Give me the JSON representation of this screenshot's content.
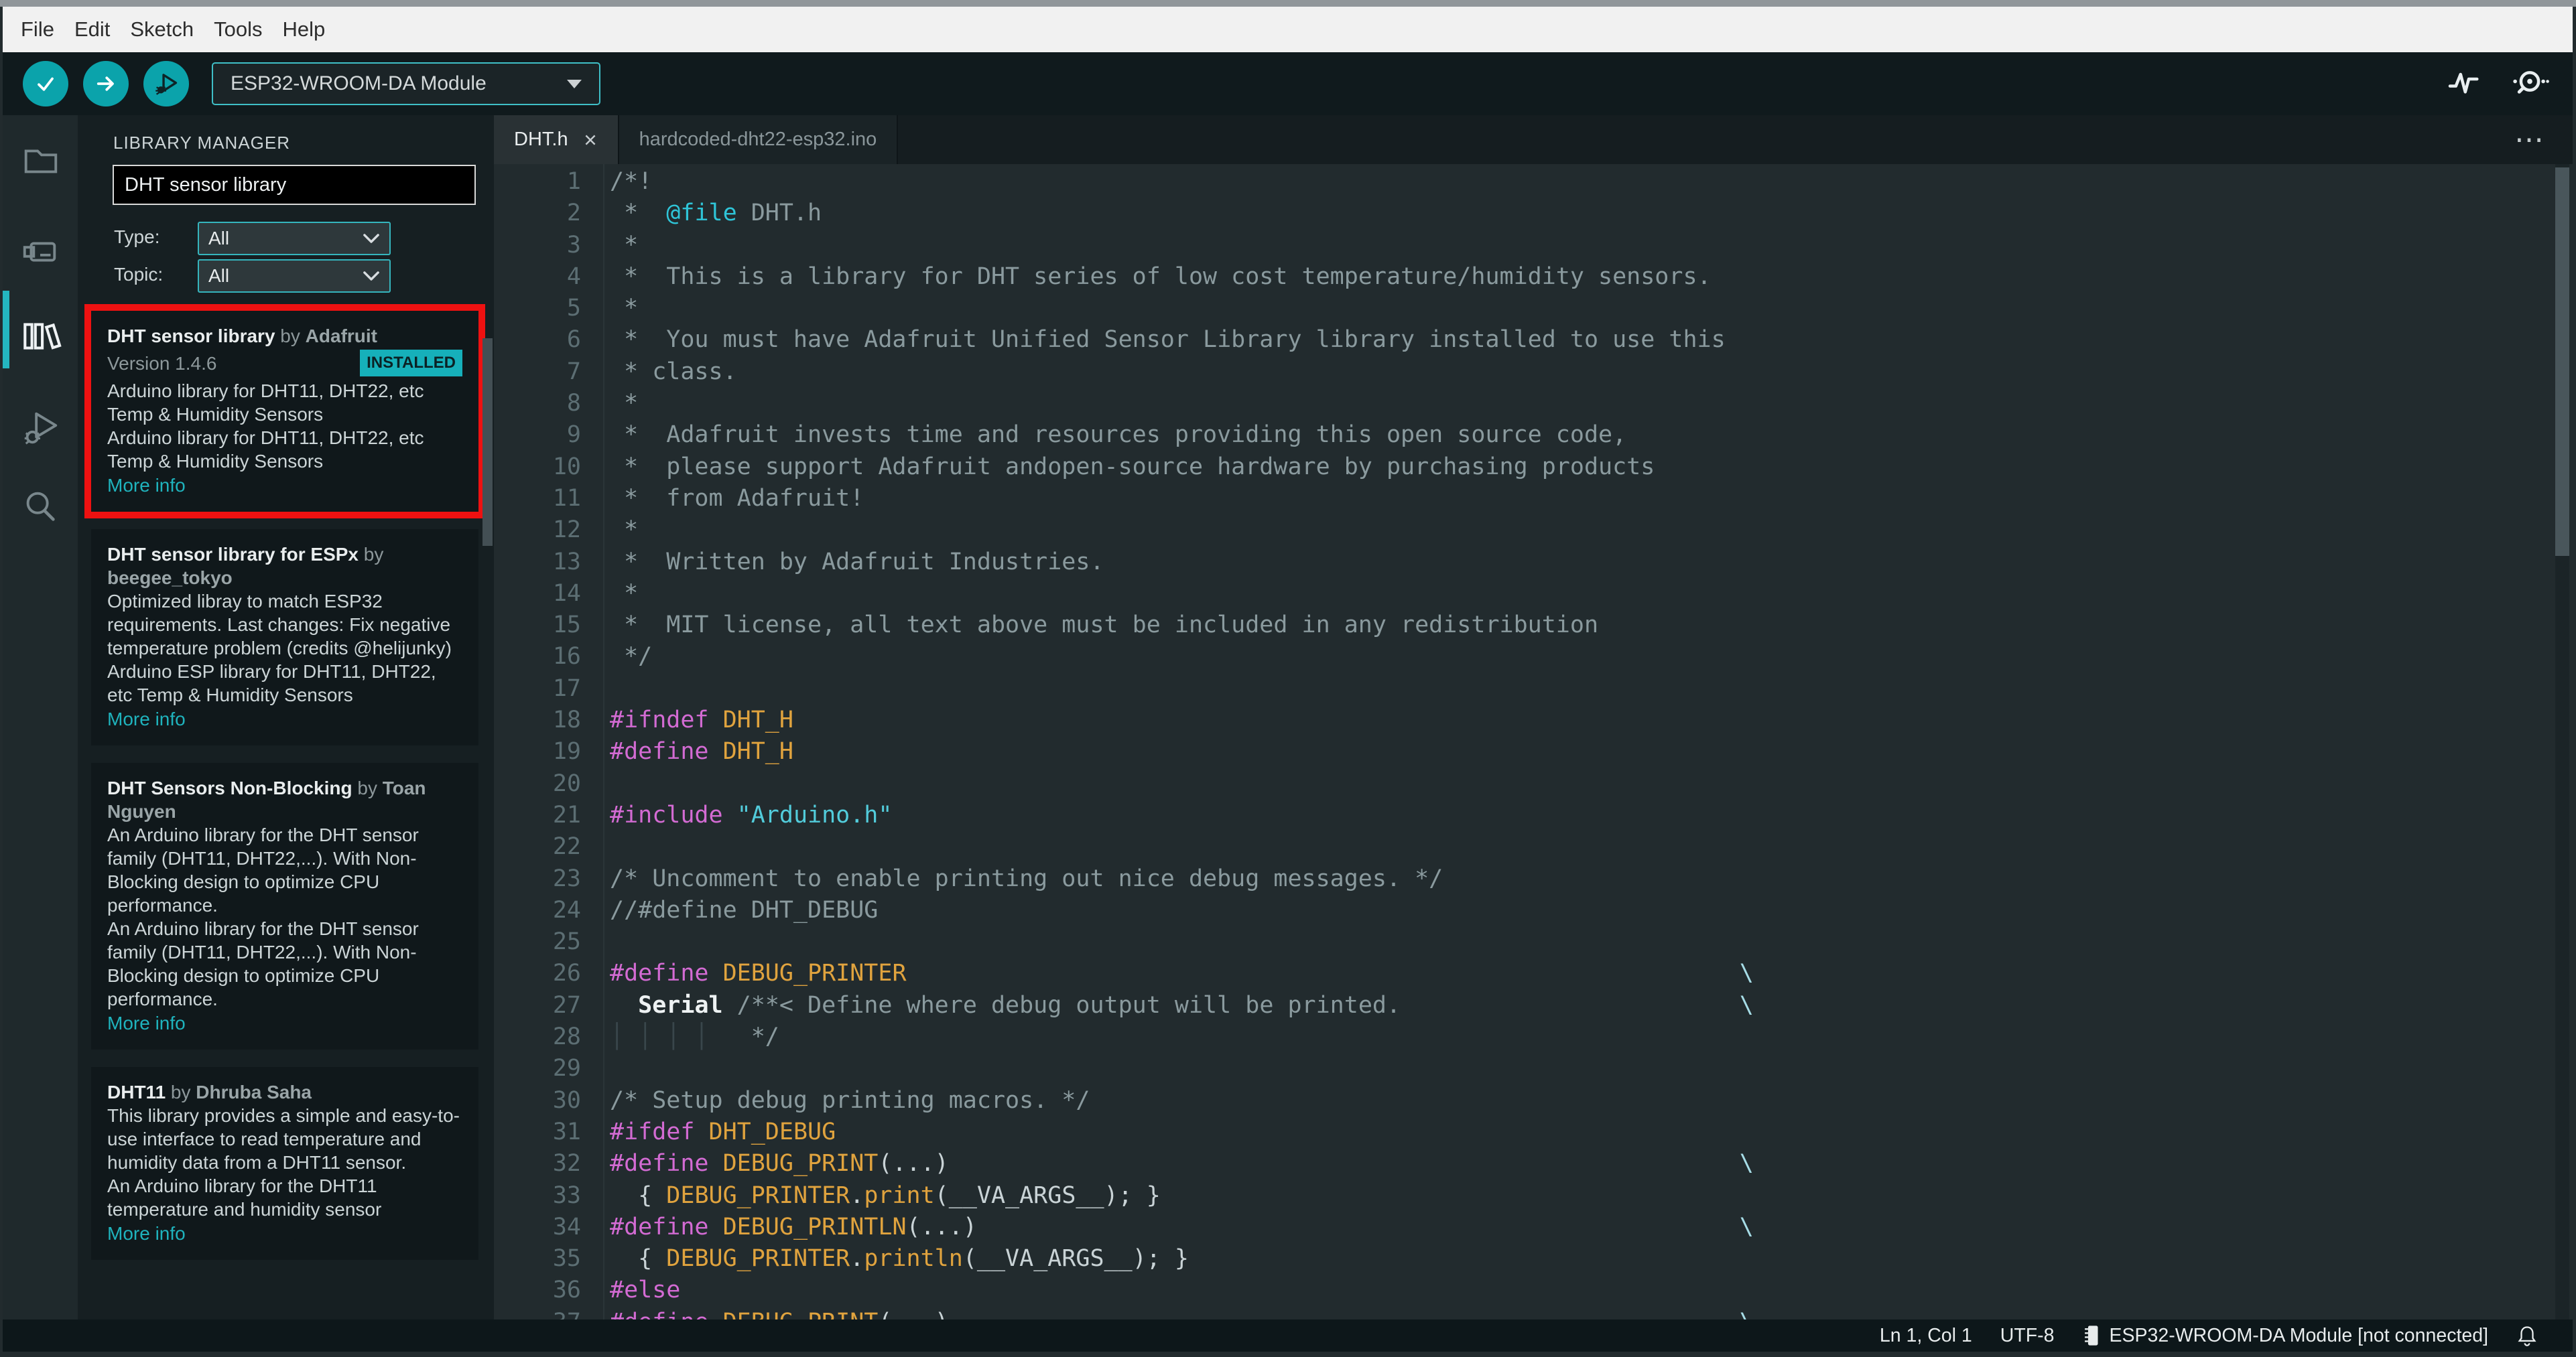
{
  "menubar": {
    "items": [
      {
        "label": "File"
      },
      {
        "label": "Edit"
      },
      {
        "label": "Sketch"
      },
      {
        "label": "Tools"
      },
      {
        "label": "Help"
      }
    ]
  },
  "toolbar": {
    "buttons": [
      {
        "name": "verify-button",
        "icon": "check-icon"
      },
      {
        "name": "upload-button",
        "icon": "arrow-right-icon"
      },
      {
        "name": "debug-button",
        "icon": "bug-play-icon"
      }
    ],
    "board_selector": {
      "value": "ESP32-WROOM-DA Module",
      "icon": "chevron-down-icon"
    },
    "right_icons": [
      {
        "name": "serial-plotter-icon"
      },
      {
        "name": "serial-monitor-icon"
      }
    ],
    "accent_teal": "#0ba3ab"
  },
  "activity_bar": {
    "items": [
      {
        "id": "sketchbook",
        "icon": "folder-icon",
        "active": false
      },
      {
        "id": "boards-manager",
        "icon": "board-icon",
        "active": false
      },
      {
        "id": "library-manager",
        "icon": "books-icon",
        "active": true
      },
      {
        "id": "debug",
        "icon": "bug-arrow-icon",
        "active": false
      },
      {
        "id": "search",
        "icon": "search-icon",
        "active": false
      }
    ]
  },
  "library_manager": {
    "title": "LIBRARY MANAGER",
    "search_value": "DHT sensor library",
    "filters": [
      {
        "label": "Type:",
        "value": "All"
      },
      {
        "label": "Topic:",
        "value": "All"
      }
    ],
    "entries": [
      {
        "name": "DHT sensor library",
        "by": " by ",
        "author": "Adafruit",
        "version": "Version 1.4.6",
        "badge": "INSTALLED",
        "highlighted": true,
        "description": [
          "Arduino library for DHT11, DHT22, etc Temp & Humidity Sensors",
          "Arduino library for DHT11, DHT22, etc Temp & Humidity Sensors"
        ],
        "link": "More info"
      },
      {
        "name": "DHT sensor library for ESPx",
        "by": " by ",
        "author": "beegee_tokyo",
        "highlighted": false,
        "description": [
          "Optimized libray to match ESP32 requirements. Last changes: Fix negative temperature problem (credits @helijunky)",
          "Arduino ESP library for DHT11, DHT22, etc Temp & Humidity Sensors"
        ],
        "link": "More info"
      },
      {
        "name": "DHT Sensors Non-Blocking",
        "by": " by ",
        "author": "Toan Nguyen",
        "highlighted": false,
        "description": [
          "An Arduino library for the DHT sensor family (DHT11, DHT22,...). With Non-Blocking design to optimize CPU performance.",
          "An Arduino library for the DHT sensor family (DHT11, DHT22,...). With Non-Blocking design to optimize CPU performance."
        ],
        "link": "More info"
      },
      {
        "name": "DHT11",
        "by": " by ",
        "author": "Dhruba Saha",
        "highlighted": false,
        "description": [
          "This library provides a simple and easy-to-use interface to read temperature and humidity data from a DHT11 sensor.",
          "An Arduino library for the DHT11 temperature and humidity sensor"
        ],
        "link": "More info"
      }
    ],
    "badge_color": "#16b0ba",
    "highlight_color": "#ee1111"
  },
  "editor": {
    "tabs": [
      {
        "label": "DHT.h",
        "active": true,
        "closable": true
      },
      {
        "label": "hardcoded-dht22-esp32.ino",
        "active": false,
        "closable": false
      }
    ],
    "more_actions_icon": "ellipsis-icon",
    "more_actions_glyph": "⋯",
    "continuation_column": 80,
    "code_lines": [
      {
        "segs": [
          [
            "c",
            "/*!"
          ]
        ]
      },
      {
        "segs": [
          [
            "c",
            " *  "
          ],
          [
            "a",
            "@file"
          ],
          [
            "c",
            " DHT.h"
          ]
        ]
      },
      {
        "segs": [
          [
            "c",
            " *"
          ]
        ]
      },
      {
        "segs": [
          [
            "c",
            " *  This is a library for DHT series of low cost temperature/humidity sensors."
          ]
        ]
      },
      {
        "segs": [
          [
            "c",
            " *"
          ]
        ]
      },
      {
        "segs": [
          [
            "c",
            " *  You must have Adafruit Unified Sensor Library library installed to use this"
          ]
        ]
      },
      {
        "segs": [
          [
            "c",
            " * class."
          ]
        ]
      },
      {
        "segs": [
          [
            "c",
            " *"
          ]
        ]
      },
      {
        "segs": [
          [
            "c",
            " *  Adafruit invests time and resources providing this open source code,"
          ]
        ]
      },
      {
        "segs": [
          [
            "c",
            " *  please support Adafruit andopen-source hardware by purchasing products"
          ]
        ]
      },
      {
        "segs": [
          [
            "c",
            " *  from Adafruit!"
          ]
        ]
      },
      {
        "segs": [
          [
            "c",
            " *"
          ]
        ]
      },
      {
        "segs": [
          [
            "c",
            " *  Written by Adafruit Industries."
          ]
        ]
      },
      {
        "segs": [
          [
            "c",
            " *"
          ]
        ]
      },
      {
        "segs": [
          [
            "c",
            " *  MIT license, all text above must be included in any redistribution"
          ]
        ]
      },
      {
        "segs": [
          [
            "c",
            " */"
          ]
        ]
      },
      {
        "segs": []
      },
      {
        "segs": [
          [
            "k",
            "#ifndef"
          ],
          [
            "p",
            " "
          ],
          [
            "m",
            "DHT_H"
          ]
        ]
      },
      {
        "segs": [
          [
            "k",
            "#define"
          ],
          [
            "p",
            " "
          ],
          [
            "m",
            "DHT_H"
          ]
        ]
      },
      {
        "segs": []
      },
      {
        "segs": [
          [
            "k",
            "#include"
          ],
          [
            "p",
            " "
          ],
          [
            "s",
            "\"Arduino.h\""
          ]
        ]
      },
      {
        "segs": []
      },
      {
        "segs": [
          [
            "c",
            "/* Uncomment to enable printing out nice debug messages. */"
          ]
        ]
      },
      {
        "segs": [
          [
            "c",
            "//#define DHT_DEBUG"
          ]
        ]
      },
      {
        "segs": []
      },
      {
        "segs": [
          [
            "k",
            "#define"
          ],
          [
            "p",
            " "
          ],
          [
            "m",
            "DEBUG_PRINTER"
          ]
        ],
        "cont": true
      },
      {
        "segs": [
          [
            "p",
            "  "
          ],
          [
            "srl",
            "Serial"
          ],
          [
            "p",
            " "
          ],
          [
            "c",
            "/**< Define where debug output will be printed."
          ]
        ],
        "cont": true
      },
      {
        "segs": [
          [
            "g",
            "│ │ │ │"
          ],
          [
            "c",
            "   */"
          ]
        ]
      },
      {
        "segs": []
      },
      {
        "segs": [
          [
            "c",
            "/* Setup debug printing macros. */"
          ]
        ]
      },
      {
        "segs": [
          [
            "k",
            "#ifdef"
          ],
          [
            "p",
            " "
          ],
          [
            "m",
            "DHT_DEBUG"
          ]
        ]
      },
      {
        "segs": [
          [
            "k",
            "#define"
          ],
          [
            "p",
            " "
          ],
          [
            "m",
            "DEBUG_PRINT"
          ],
          [
            "p",
            "(...)"
          ]
        ],
        "cont": true
      },
      {
        "segs": [
          [
            "p",
            "  { "
          ],
          [
            "m",
            "DEBUG_PRINTER"
          ],
          [
            "p",
            "."
          ],
          [
            "m",
            "print"
          ],
          [
            "p",
            "("
          ],
          [
            "p",
            "__VA_ARGS__"
          ],
          [
            "p",
            "); }"
          ]
        ]
      },
      {
        "segs": [
          [
            "k",
            "#define"
          ],
          [
            "p",
            " "
          ],
          [
            "m",
            "DEBUG_PRINTLN"
          ],
          [
            "p",
            "(...)"
          ]
        ],
        "cont": true
      },
      {
        "segs": [
          [
            "p",
            "  { "
          ],
          [
            "m",
            "DEBUG_PRINTER"
          ],
          [
            "p",
            "."
          ],
          [
            "m",
            "println"
          ],
          [
            "p",
            "("
          ],
          [
            "p",
            "__VA_ARGS__"
          ],
          [
            "p",
            "); }"
          ]
        ]
      },
      {
        "segs": [
          [
            "k",
            "#else"
          ]
        ]
      },
      {
        "segs": [
          [
            "k",
            "#define"
          ],
          [
            "p",
            " "
          ],
          [
            "m",
            "DEBUG_PRINT"
          ],
          [
            "p",
            "(...)"
          ]
        ],
        "cont": true
      }
    ]
  },
  "statusbar": {
    "position": "Ln 1, Col 1",
    "encoding": "UTF-8",
    "board_status": "ESP32-WROOM-DA Module [not connected]",
    "icons": [
      "chip-icon",
      "bell-icon"
    ]
  }
}
